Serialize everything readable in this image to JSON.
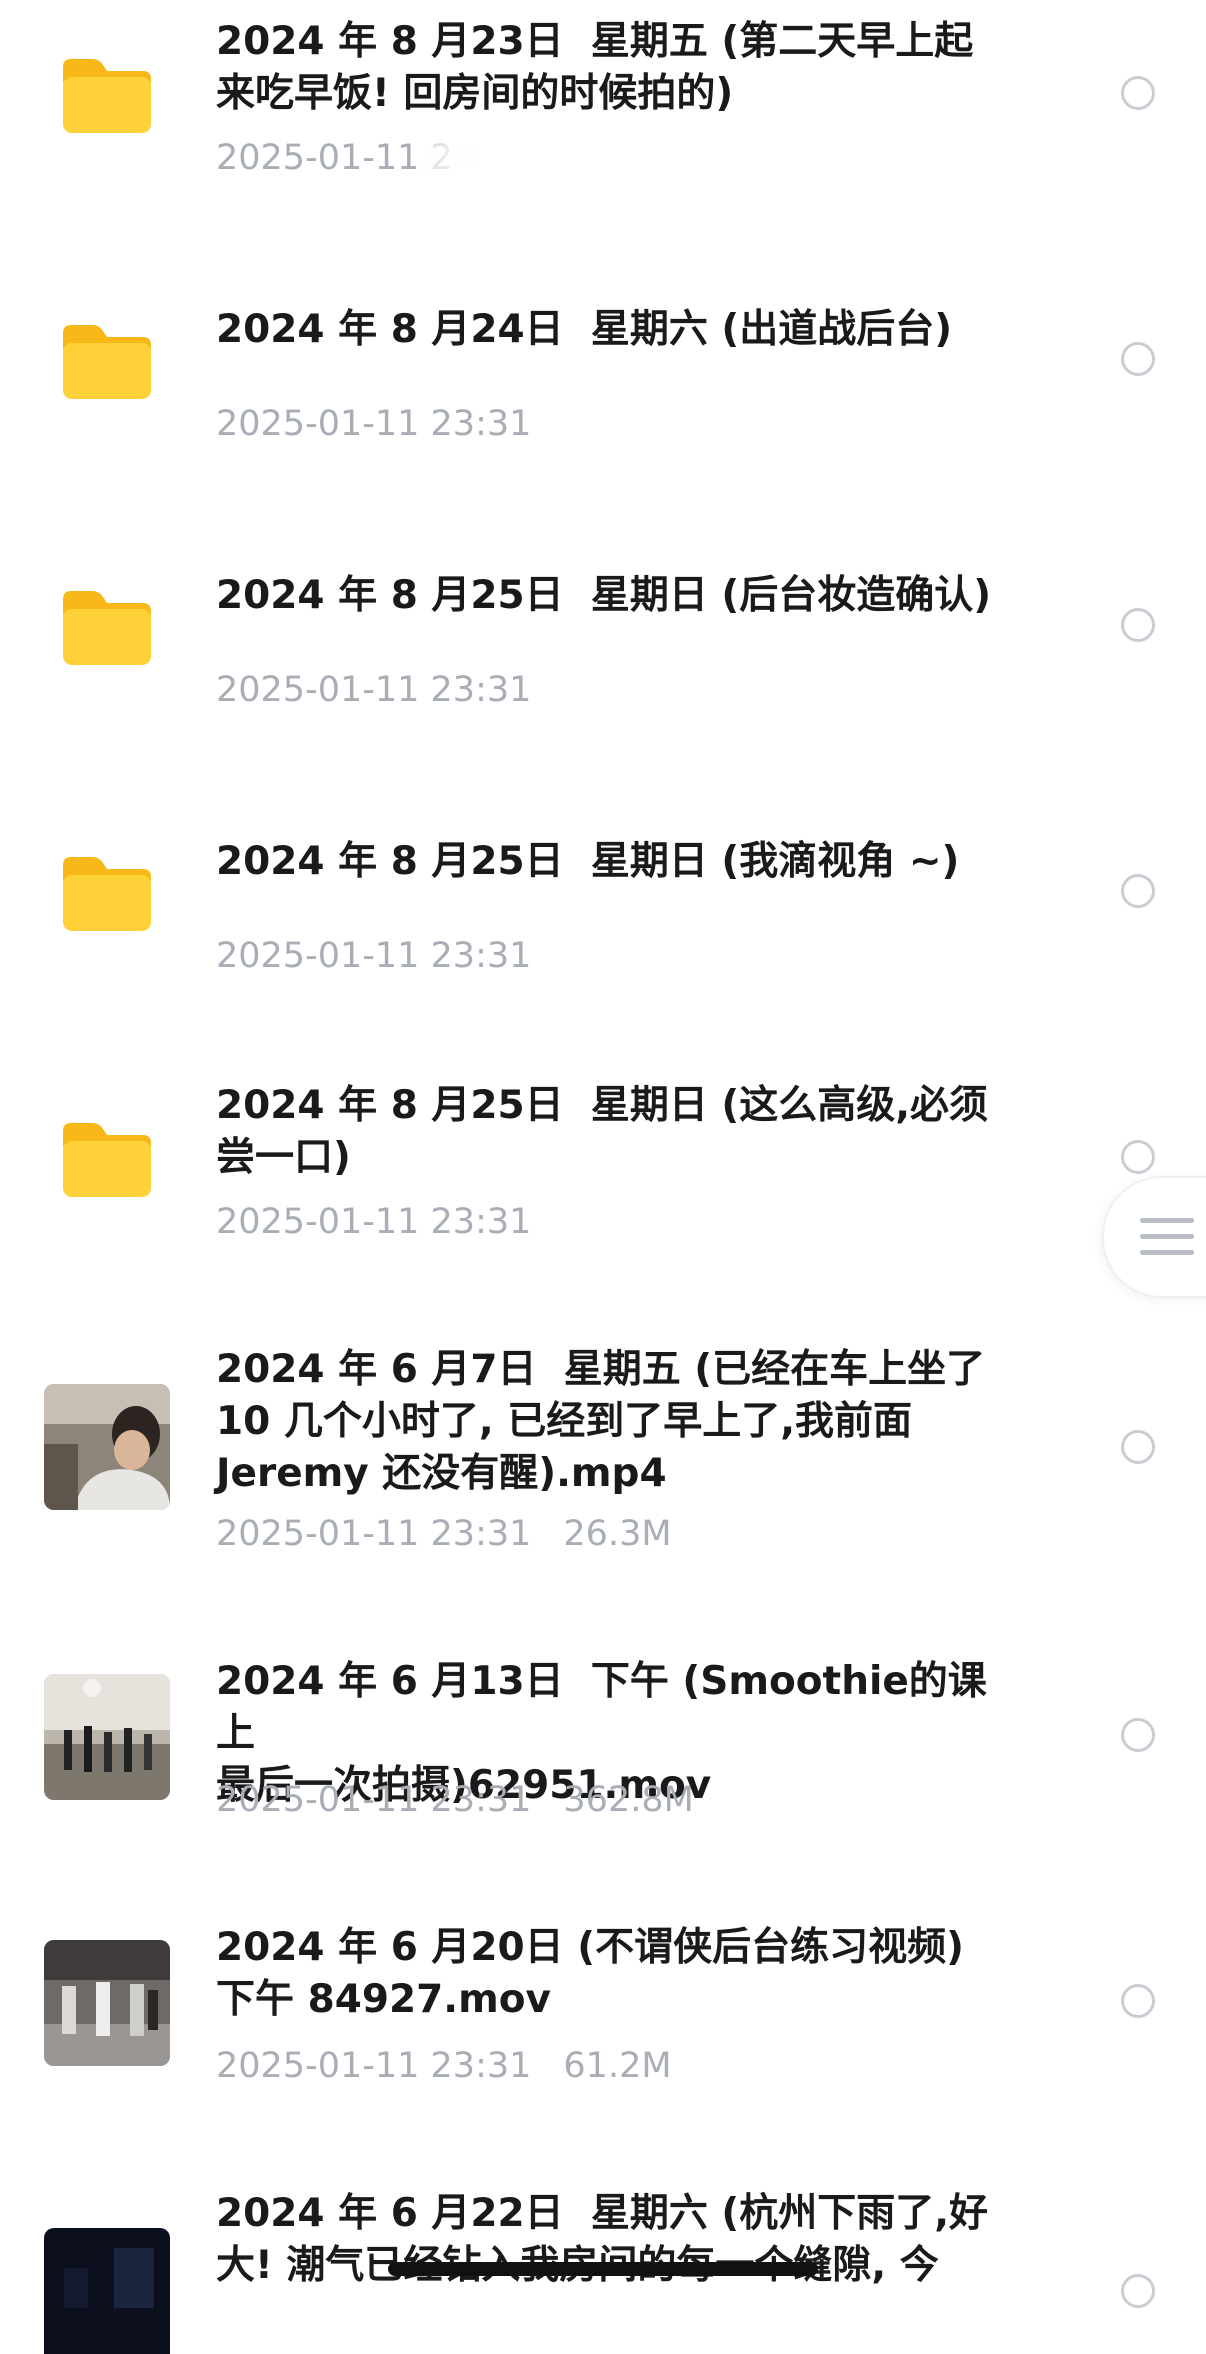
{
  "files": [
    {
      "kind": "folder",
      "title": "2024 年 8 月23日  星期五 (第二天早上起\n来吃早饭! 回房间的时候拍的)",
      "date": "2025-01-11 2",
      "size": ""
    },
    {
      "kind": "folder",
      "title": "2024 年 8 月24日  星期六 (出道战后台)",
      "date": "2025-01-11 23:31",
      "size": ""
    },
    {
      "kind": "folder",
      "title": "2024 年 8 月25日  星期日 (后台妆造确认)",
      "date": "2025-01-11 23:31",
      "size": ""
    },
    {
      "kind": "folder",
      "title": "2024 年 8 月25日  星期日 (我滴视角 ~)",
      "date": "2025-01-11 23:31",
      "size": ""
    },
    {
      "kind": "folder",
      "title": "2024 年 8 月25日  星期日 (这么高级,必须\n尝一口)",
      "date": "2025-01-11 23:31",
      "size": ""
    },
    {
      "kind": "video",
      "title": "2024 年 6 月7日  星期五 (已经在车上坐了\n10 几个小时了, 已经到了早上了,我前面\nJeremy 还没有醒).mp4",
      "date": "2025-01-11 23:31",
      "size": "26.3M"
    },
    {
      "kind": "video",
      "title": "2024 年 6 月13日  下午 (Smoothie的课上\n最后一次拍摄)62951.mov",
      "date": "2025-01-11 23:31",
      "size": "362.8M"
    },
    {
      "kind": "video",
      "title": "2024 年 6 月20日 (不谓侠后台练习视频)\n下午 84927.mov",
      "date": "2025-01-11 23:31",
      "size": "61.2M"
    },
    {
      "kind": "video",
      "title": "2024 年 6 月22日  星期六 (杭州下雨了,好\n大! 潮气已经钻入我房间的每一个缝隙, 今",
      "date": "",
      "size": ""
    }
  ],
  "icons": {
    "folder": "folder-icon",
    "select": "radio-circle-icon",
    "menu": "menu-lines-icon"
  },
  "colors": {
    "folder_yellow": "#FFCC33",
    "title_text": "#1a1a1a",
    "meta_text": "#a8adb6",
    "radio_border": "#c9ccd2"
  }
}
